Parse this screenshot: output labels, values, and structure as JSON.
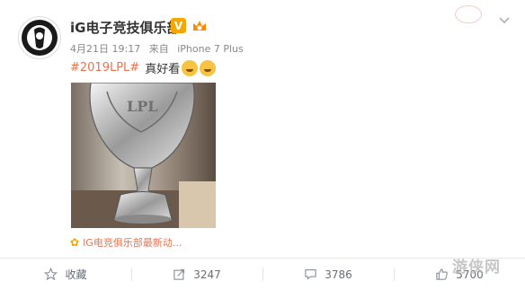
{
  "post": {
    "author": "iG电子竞技俱乐部",
    "verified_badge": "V",
    "vip_badge": "会",
    "meta": {
      "date": "4月21日 19:17",
      "source_prefix": "来自",
      "source": "iPhone 7 Plus"
    },
    "text": {
      "hashtag": "#2019LPL#",
      "body": "真好看"
    },
    "image_icon": "trophy-photo",
    "app_link": "IG电竞俱乐部最新动..."
  },
  "actions": [
    {
      "label": "收藏",
      "icon": "star-icon"
    },
    {
      "label": "3247",
      "icon": "share-icon"
    },
    {
      "label": "3786",
      "icon": "comment-icon"
    },
    {
      "label": "5700",
      "icon": "like-icon"
    }
  ],
  "watermark": "游侠网",
  "colors": {
    "hashtag": "#eb7350",
    "verified": "#f7a600",
    "icon": "#696e78"
  }
}
